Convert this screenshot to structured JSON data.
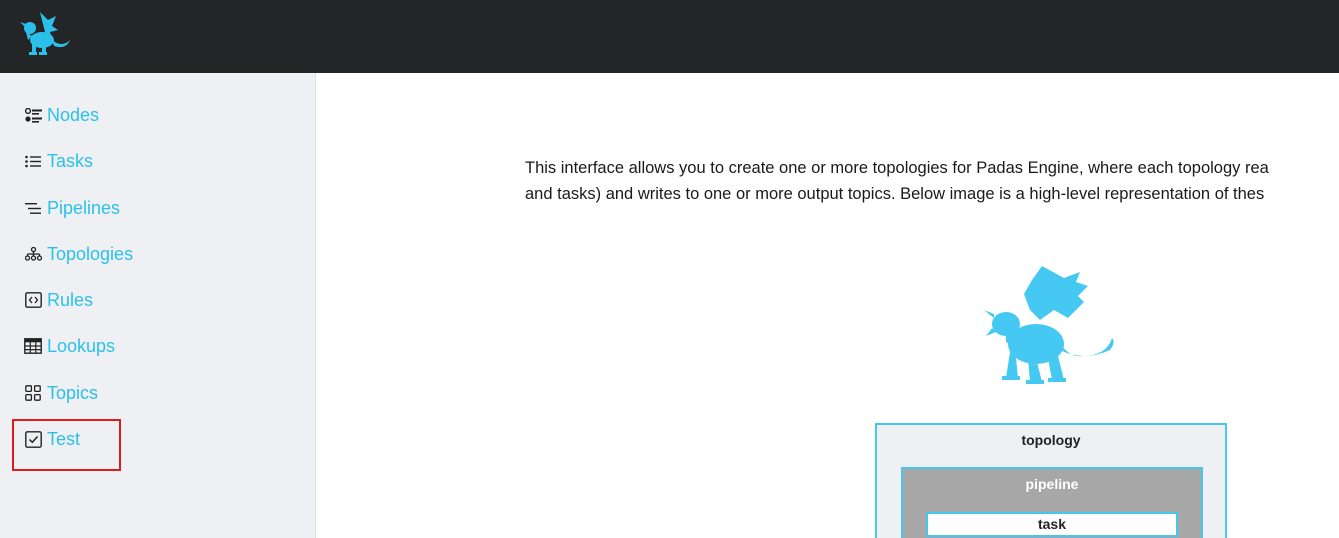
{
  "app": {
    "logo_icon": "padas-dragon-logo",
    "accent_color": "#2bc0ea",
    "header_bg": "#232527"
  },
  "sidebar": {
    "items": [
      {
        "label": "Nodes",
        "icon": "nodes-icon"
      },
      {
        "label": "Tasks",
        "icon": "list-icon"
      },
      {
        "label": "Pipelines",
        "icon": "pipelines-icon"
      },
      {
        "label": "Topologies",
        "icon": "hierarchy-icon"
      },
      {
        "label": "Rules",
        "icon": "code-icon"
      },
      {
        "label": "Lookups",
        "icon": "table-icon"
      },
      {
        "label": "Topics",
        "icon": "grid-icon"
      },
      {
        "label": "Test",
        "icon": "checkbox-icon"
      }
    ],
    "highlight_color": "#e01b1b"
  },
  "main": {
    "intro_line1": "This interface allows you to create one or more topologies for Padas Engine, where each topology rea",
    "intro_line2": "and tasks) and writes to one or more output topics. Below image is a high-level representation of thes",
    "diagram": {
      "topology_label": "topology",
      "pipeline_label": "pipeline",
      "task_label": "task"
    }
  }
}
